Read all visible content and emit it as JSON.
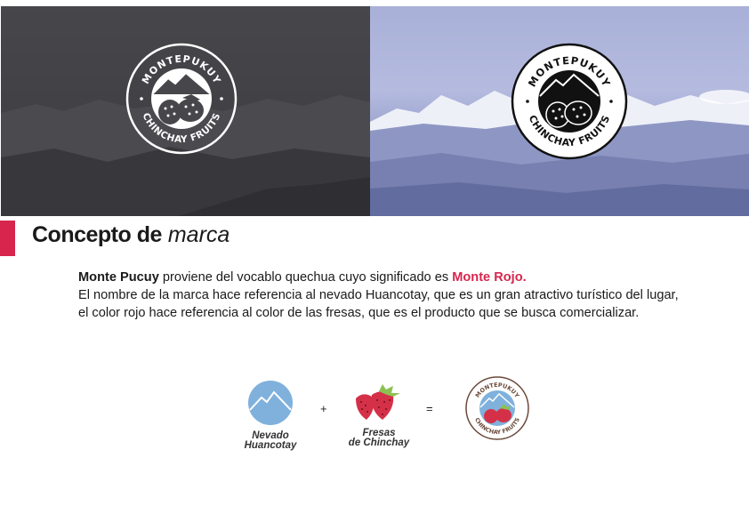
{
  "banner": {
    "logo_top_text": "MONTEPUKUY",
    "logo_bottom_text": "CHINCHAY FRUITS"
  },
  "heading": {
    "bold": "Concepto de",
    "italic": "marca"
  },
  "body": {
    "brand_name": "Monte Pucuy",
    "line1_rest": " proviene del vocablo quechua cuyo significado es ",
    "meaning": "Monte Rojo.",
    "paragraph": "El nombre de la marca hace referencia al nevado Huancotay, que es un gran atractivo turístico del lugar, el color rojo hace referencia al color de las fresas, que es el producto que se busca comercializar."
  },
  "equation": {
    "item1_line1": "Nevado",
    "item1_line2": "Huancotay",
    "plus": "+",
    "item2_line1": "Fresas",
    "item2_line2": "de Chinchay",
    "equals": "="
  },
  "colors": {
    "accent": "#d6264e",
    "mountain_blue": "#7fb1dc",
    "strawberry_red": "#d43148",
    "leaf_green": "#8cc152",
    "logo_brown": "#6b4a3a"
  },
  "icons": {
    "logo": "montepukuy-logo-icon",
    "mountain": "mountain-circle-icon",
    "strawberry": "strawberry-icon"
  }
}
